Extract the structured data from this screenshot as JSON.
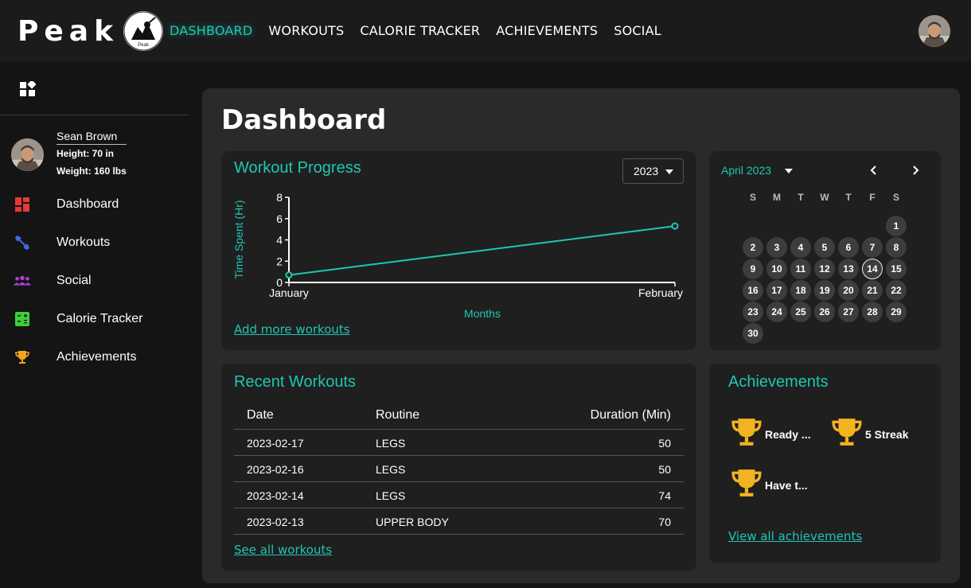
{
  "app": {
    "brand": "Peak",
    "logo_text": "Peak"
  },
  "nav": {
    "items": [
      {
        "label": "DASHBOARD",
        "active": true
      },
      {
        "label": "WORKOUTS",
        "active": false
      },
      {
        "label": "CALORIE TRACKER",
        "active": false
      },
      {
        "label": "ACHIEVEMENTS",
        "active": false
      },
      {
        "label": "SOCIAL",
        "active": false
      }
    ]
  },
  "profile": {
    "name": "Sean Brown",
    "height": "Height: 70 in",
    "weight": "Weight: 160 lbs"
  },
  "sidebar": {
    "items": [
      {
        "label": "Dashboard",
        "icon": "dashboard-icon",
        "color": "#e53935"
      },
      {
        "label": "Workouts",
        "icon": "dumbbell-icon",
        "color": "#3f6ee8"
      },
      {
        "label": "Social",
        "icon": "people-icon",
        "color": "#b03fd8"
      },
      {
        "label": "Calorie Tracker",
        "icon": "calculator-icon",
        "color": "#3ccf3c"
      },
      {
        "label": "Achievements",
        "icon": "trophy-icon",
        "color": "#f2a81d"
      }
    ]
  },
  "page": {
    "title": "Dashboard"
  },
  "progress": {
    "title": "Workout Progress",
    "year": "2023",
    "add_link": "Add more workouts"
  },
  "chart_data": {
    "type": "line",
    "categories": [
      "January",
      "February"
    ],
    "values": [
      0.7,
      5.3
    ],
    "ylabel": "Time Spent (Hr)",
    "xlabel": "Months",
    "ylim": [
      0,
      8
    ],
    "yticks": [
      "0",
      "2",
      "4",
      "6",
      "8"
    ],
    "grid": false,
    "color": "#1fc7b2"
  },
  "calendar": {
    "month_label": "April 2023",
    "weekdays": [
      "S",
      "M",
      "T",
      "W",
      "T",
      "F",
      "S"
    ],
    "days": [
      "1",
      "2",
      "3",
      "4",
      "5",
      "6",
      "7",
      "8",
      "9",
      "10",
      "11",
      "12",
      "13",
      "14",
      "15",
      "16",
      "17",
      "18",
      "19",
      "20",
      "21",
      "22",
      "23",
      "24",
      "25",
      "26",
      "27",
      "28",
      "29",
      "30"
    ],
    "today": "14"
  },
  "recent": {
    "title": "Recent Workouts",
    "headers": [
      "Date",
      "Routine",
      "Duration (Min)"
    ],
    "rows": [
      {
        "date": "2023-02-17",
        "routine": "LEGS",
        "duration": "50"
      },
      {
        "date": "2023-02-16",
        "routine": "LEGS",
        "duration": "50"
      },
      {
        "date": "2023-02-14",
        "routine": "LEGS",
        "duration": "74"
      },
      {
        "date": "2023-02-13",
        "routine": "UPPER BODY",
        "duration": "70"
      }
    ],
    "see_all": "See all workouts"
  },
  "achievements": {
    "title": "Achievements",
    "items": [
      {
        "label": "Ready ..."
      },
      {
        "label": "5 Streak"
      },
      {
        "label": "Have t..."
      }
    ],
    "view_all": "View all achievements",
    "trophy_color": "#f2b320"
  }
}
